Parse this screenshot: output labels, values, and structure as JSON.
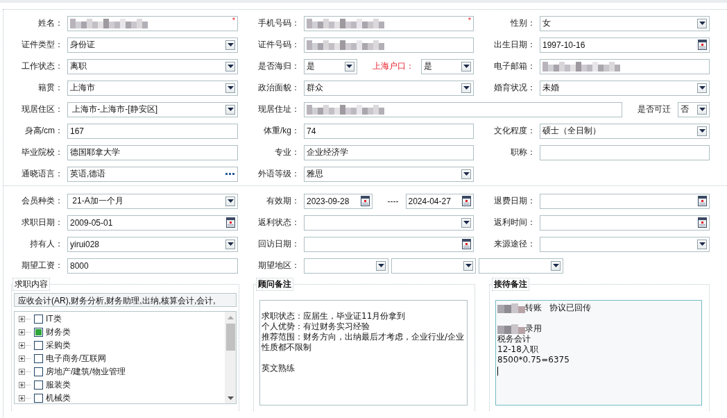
{
  "personal_section": {
    "rows": [
      {
        "groups": [
          {
            "label": "姓名：",
            "controls": [
              {
                "kind": "text",
                "redacted": true,
                "required_mark": "*"
              }
            ]
          },
          {
            "label": "手机号码：",
            "controls": [
              {
                "kind": "text",
                "redacted": true,
                "required_mark": "*"
              }
            ]
          },
          {
            "label": "性别：",
            "controls": [
              {
                "kind": "select",
                "value": "女"
              }
            ]
          }
        ]
      },
      {
        "groups": [
          {
            "label": "证件类型：",
            "controls": [
              {
                "kind": "select",
                "value": "身份证"
              }
            ]
          },
          {
            "label": "证件号码：",
            "controls": [
              {
                "kind": "text",
                "redacted": true
              }
            ]
          },
          {
            "label": "出生日期：",
            "controls": [
              {
                "kind": "date",
                "value": "1997-10-16"
              }
            ]
          }
        ]
      },
      {
        "groups": [
          {
            "label": "工作状态：",
            "controls": [
              {
                "kind": "select",
                "value": "离职"
              }
            ]
          },
          {
            "label": "是否海归：",
            "controls": [
              {
                "kind": "select",
                "value": "是"
              },
              {
                "kind": "caption",
                "text": "上海户口：",
                "highlighted": true
              },
              {
                "kind": "select",
                "value": "是"
              }
            ]
          },
          {
            "label": "电子邮箱：",
            "controls": [
              {
                "kind": "text",
                "redacted": true
              }
            ]
          }
        ]
      },
      {
        "groups": [
          {
            "label": "籍贯：",
            "controls": [
              {
                "kind": "select",
                "value": "上海市"
              }
            ]
          },
          {
            "label": "政治面貌：",
            "controls": [
              {
                "kind": "select",
                "value": "群众"
              }
            ]
          },
          {
            "label": "婚育状况：",
            "controls": [
              {
                "kind": "select",
                "value": "未婚"
              }
            ]
          }
        ]
      },
      {
        "groups": [
          {
            "label": "现居住区：",
            "controls": [
              {
                "kind": "select",
                "value": " 上海市-上海市-[静安区]"
              }
            ]
          },
          {
            "label": "现居住址：",
            "controls": [
              {
                "kind": "text",
                "redacted": true
              },
              {
                "kind": "caption",
                "text": "是否可迁",
                "highlighted": false
              },
              {
                "kind": "select",
                "value": "否"
              }
            ]
          }
        ]
      },
      {
        "groups": [
          {
            "label": "身高/cm：",
            "controls": [
              {
                "kind": "text",
                "value": "167"
              }
            ]
          },
          {
            "label": "体重/kg：",
            "controls": [
              {
                "kind": "text",
                "value": "74"
              }
            ]
          },
          {
            "label": "文化程度：",
            "controls": [
              {
                "kind": "select",
                "value": "硕士（全日制）"
              }
            ]
          }
        ]
      },
      {
        "groups": [
          {
            "label": "毕业院校：",
            "controls": [
              {
                "kind": "text",
                "value": "德国耶拿大学"
              }
            ]
          },
          {
            "label": "专业：",
            "controls": [
              {
                "kind": "text",
                "value": "企业经济学"
              }
            ]
          },
          {
            "label": "职称：",
            "controls": [
              {
                "kind": "text"
              }
            ]
          }
        ]
      },
      {
        "groups": [
          {
            "label": "通晓语言：",
            "controls": [
              {
                "kind": "picker",
                "value": "英语,德语"
              }
            ]
          },
          {
            "label": "外语等级：",
            "controls": [
              {
                "kind": "select",
                "value": "雅思"
              }
            ]
          }
        ]
      }
    ]
  },
  "membership_section": {
    "rows": [
      {
        "groups": [
          {
            "label": "会员种类：",
            "controls": [
              {
                "kind": "select",
                "value": " 21-A加一个月"
              }
            ]
          },
          {
            "label": "有效期：",
            "controls": [
              {
                "kind": "date",
                "value": "2023-09-28"
              },
              {
                "kind": "caption",
                "text": "----",
                "highlighted": false
              },
              {
                "kind": "date",
                "value": "2024-04-27"
              }
            ]
          },
          {
            "label": "退费日期：",
            "controls": [
              {
                "kind": "date"
              }
            ]
          }
        ]
      },
      {
        "groups": [
          {
            "label": "求职日期：",
            "controls": [
              {
                "kind": "date",
                "value": "2009-05-01"
              }
            ]
          },
          {
            "label": "返利状态：",
            "controls": [
              {
                "kind": "select"
              }
            ]
          },
          {
            "label": "返利时间：",
            "controls": [
              {
                "kind": "date"
              }
            ]
          }
        ]
      },
      {
        "groups": [
          {
            "label": "持有人：",
            "controls": [
              {
                "kind": "select",
                "value": "yirui028"
              }
            ]
          },
          {
            "label": "回访日期：",
            "controls": [
              {
                "kind": "date"
              }
            ]
          },
          {
            "label": "来源途径：",
            "controls": [
              {
                "kind": "select"
              }
            ]
          }
        ]
      },
      {
        "groups": [
          {
            "label": "期望工资：",
            "controls": [
              {
                "kind": "text",
                "value": "8000"
              }
            ]
          },
          {
            "label": "期望地区：",
            "controls": [
              {
                "kind": "select"
              },
              {
                "kind": "select"
              },
              {
                "kind": "select"
              }
            ]
          }
        ]
      }
    ]
  },
  "job_content": {
    "title": "求职内容",
    "summary": "应收会计(AR),财务分析,财务助理,出纳,核算会计,会计,",
    "categories": [
      {
        "label": "IT类",
        "checked": false
      },
      {
        "label": "财务类",
        "checked": true
      },
      {
        "label": "采购类",
        "checked": false
      },
      {
        "label": "电子商务/互联网",
        "checked": false
      },
      {
        "label": "房地产/建筑/物业管理",
        "checked": false
      },
      {
        "label": "服装类",
        "checked": false
      },
      {
        "label": "机械类",
        "checked": false
      }
    ]
  },
  "advisor_notes": {
    "title": "顾问备注",
    "paragraphs": [
      {
        "lines": [
          {
            "text": "求职状态：应届生，毕业证11月份拿到"
          },
          {
            "text": "个人优势：有过财务实习经验"
          },
          {
            "text": "推荐范围：财务方向，出纳最后才考虑，企业行业/企业性质都不限制"
          }
        ]
      },
      {
        "lines": [
          {
            "text": "英文熟练"
          }
        ]
      }
    ]
  },
  "reception_notes": {
    "title": "接待备注",
    "cursor": true,
    "paragraphs": [
      {
        "lines": [
          {
            "redacted": true,
            "text": "转账   协议已回传"
          }
        ]
      },
      {
        "lines": [
          {
            "redacted": true,
            "text": "录用"
          },
          {
            "redacted": false,
            "text": "税务会计"
          },
          {
            "redacted": false,
            "text": "12-18入职"
          },
          {
            "redacted": false,
            "text": "8500*0.75=6375"
          }
        ]
      }
    ]
  }
}
